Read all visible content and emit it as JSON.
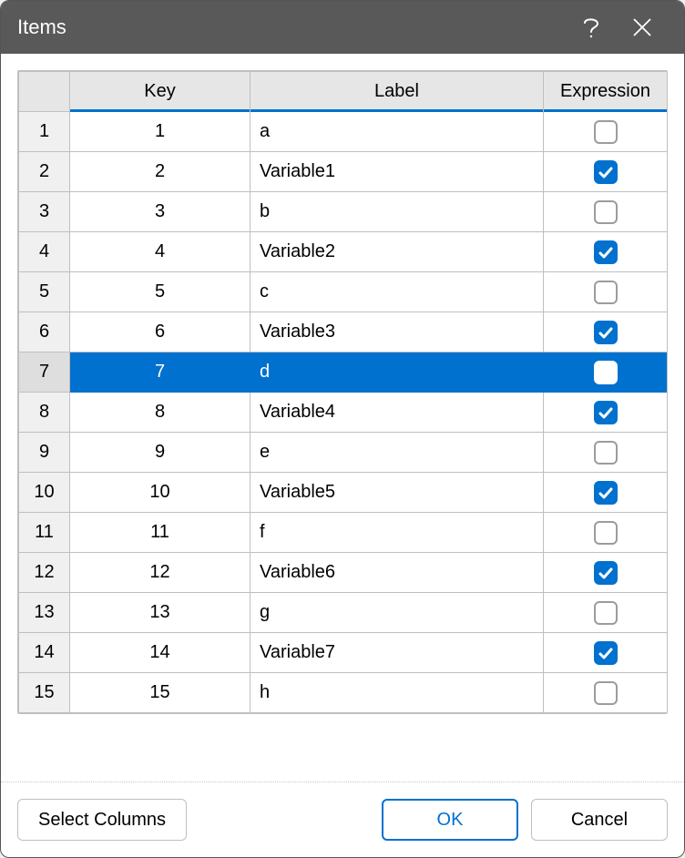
{
  "dialog": {
    "title": "Items"
  },
  "columns": {
    "key": "Key",
    "label": "Label",
    "expression": "Expression"
  },
  "rows": [
    {
      "n": "1",
      "key": "1",
      "label": "a",
      "expr": false,
      "selected": false
    },
    {
      "n": "2",
      "key": "2",
      "label": "Variable1",
      "expr": true,
      "selected": false
    },
    {
      "n": "3",
      "key": "3",
      "label": "b",
      "expr": false,
      "selected": false
    },
    {
      "n": "4",
      "key": "4",
      "label": "Variable2",
      "expr": true,
      "selected": false
    },
    {
      "n": "5",
      "key": "5",
      "label": "c",
      "expr": false,
      "selected": false
    },
    {
      "n": "6",
      "key": "6",
      "label": "Variable3",
      "expr": true,
      "selected": false
    },
    {
      "n": "7",
      "key": "7",
      "label": "d",
      "expr": false,
      "selected": true
    },
    {
      "n": "8",
      "key": "8",
      "label": "Variable4",
      "expr": true,
      "selected": false
    },
    {
      "n": "9",
      "key": "9",
      "label": "e",
      "expr": false,
      "selected": false
    },
    {
      "n": "10",
      "key": "10",
      "label": "Variable5",
      "expr": true,
      "selected": false
    },
    {
      "n": "11",
      "key": "11",
      "label": "f",
      "expr": false,
      "selected": false
    },
    {
      "n": "12",
      "key": "12",
      "label": "Variable6",
      "expr": true,
      "selected": false
    },
    {
      "n": "13",
      "key": "13",
      "label": "g",
      "expr": false,
      "selected": false
    },
    {
      "n": "14",
      "key": "14",
      "label": "Variable7",
      "expr": true,
      "selected": false
    },
    {
      "n": "15",
      "key": "15",
      "label": "h",
      "expr": false,
      "selected": false
    }
  ],
  "buttons": {
    "select_columns": "Select Columns",
    "ok": "OK",
    "cancel": "Cancel"
  }
}
